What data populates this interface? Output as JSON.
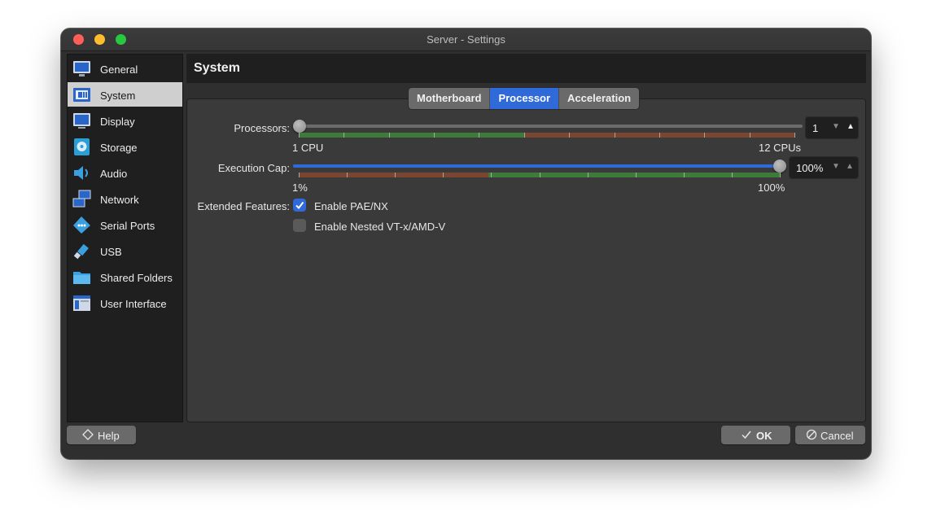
{
  "window": {
    "title": "Server - Settings"
  },
  "sidebar": {
    "items": [
      {
        "label": "General",
        "icon": "general-icon",
        "selected": false
      },
      {
        "label": "System",
        "icon": "system-icon",
        "selected": true
      },
      {
        "label": "Display",
        "icon": "display-icon",
        "selected": false
      },
      {
        "label": "Storage",
        "icon": "storage-icon",
        "selected": false
      },
      {
        "label": "Audio",
        "icon": "audio-icon",
        "selected": false
      },
      {
        "label": "Network",
        "icon": "network-icon",
        "selected": false
      },
      {
        "label": "Serial Ports",
        "icon": "serial-ports-icon",
        "selected": false
      },
      {
        "label": "USB",
        "icon": "usb-icon",
        "selected": false
      },
      {
        "label": "Shared Folders",
        "icon": "shared-folders-icon",
        "selected": false
      },
      {
        "label": "User Interface",
        "icon": "user-interface-icon",
        "selected": false
      }
    ]
  },
  "header": {
    "title": "System"
  },
  "tabs": [
    {
      "label": "Motherboard",
      "active": false
    },
    {
      "label": "Processor",
      "active": true
    },
    {
      "label": "Acceleration",
      "active": false
    }
  ],
  "processor": {
    "processors": {
      "label": "Processors:",
      "value": "1",
      "min_label": "1 CPU",
      "max_label": "12 CPUs",
      "min": 1,
      "max": 12,
      "current": 1,
      "recommended_max": 6
    },
    "execution_cap": {
      "label": "Execution Cap:",
      "value": "100%",
      "min_label": "1%",
      "max_label": "100%",
      "min": 1,
      "max": 100,
      "current": 100,
      "warning_below": 40
    },
    "extended_features": {
      "label": "Extended Features:",
      "pae_nx": {
        "label": "Enable PAE/NX",
        "checked": true
      },
      "nested_vt": {
        "label": "Enable Nested VT-x/AMD-V",
        "checked": false
      }
    }
  },
  "footer": {
    "help_label": "Help",
    "ok_label": "OK",
    "cancel_label": "Cancel"
  },
  "colors": {
    "accent": "#2f6ad8",
    "scale_good": "#3e7a3a",
    "scale_warn": "#7a4632",
    "window_bg": "#2f2f2f",
    "sidebar_bg": "#1f1f1f"
  }
}
